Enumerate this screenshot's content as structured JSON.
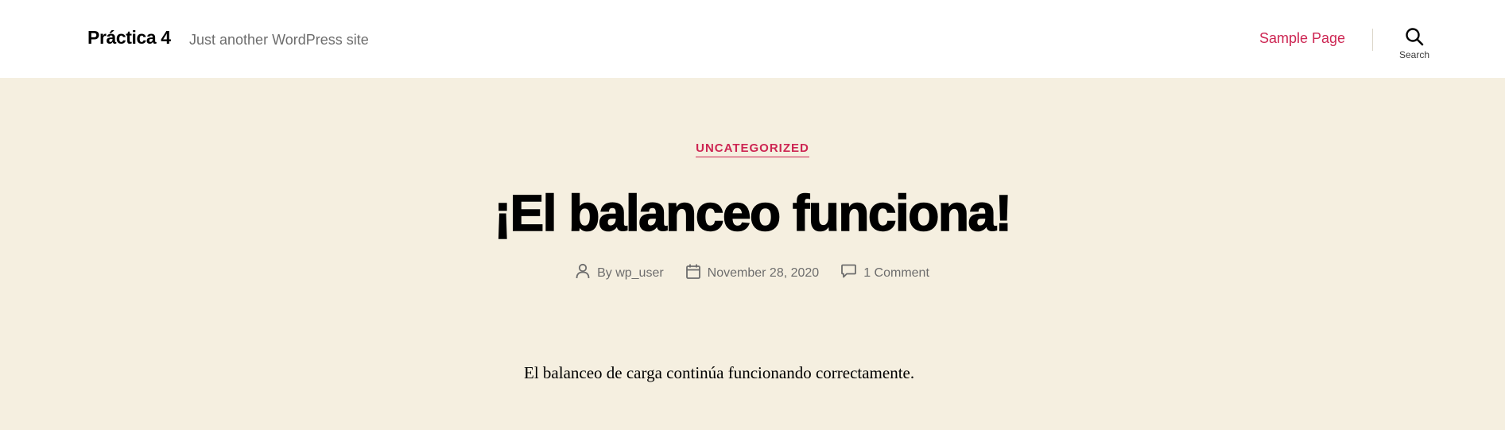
{
  "header": {
    "site_title": "Práctica 4",
    "site_description": "Just another WordPress site",
    "nav": [
      {
        "label": "Sample Page"
      }
    ],
    "search_label": "Search",
    "search_icon": "search-icon"
  },
  "post": {
    "category": "UNCATEGORIZED",
    "title": "¡El balanceo funciona!",
    "author_label": "By wp_user",
    "date": "November 28, 2020",
    "comments": "1 Comment",
    "content": "El balanceo de carga continúa funcionando correctamente."
  },
  "colors": {
    "accent": "#cd2653",
    "header_bg": "#ffffff",
    "page_bg": "#f5efe0",
    "meta_text": "#6d6d6d"
  }
}
